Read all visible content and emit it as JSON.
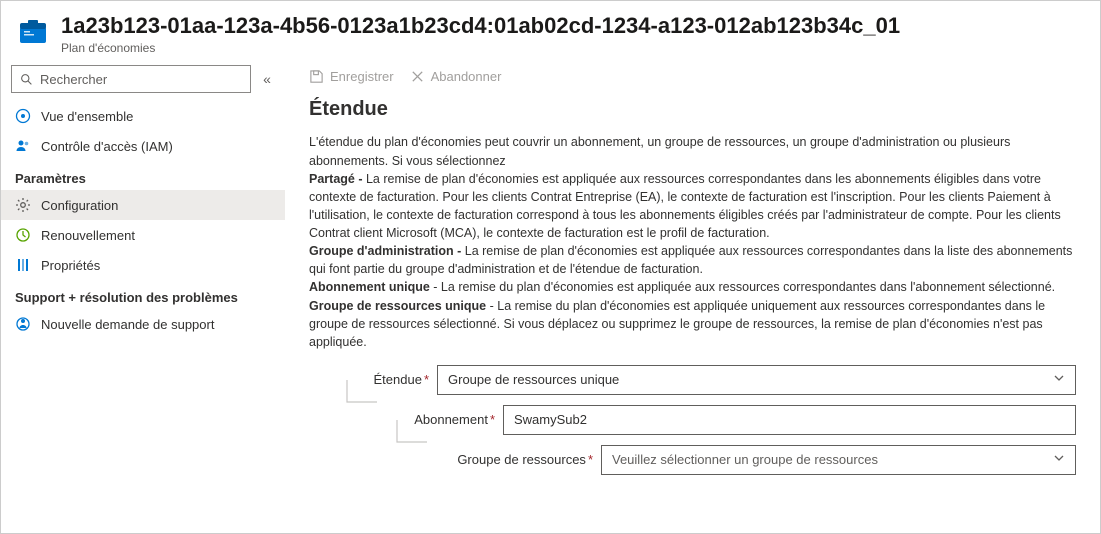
{
  "header": {
    "title": "1a23b123-01aa-123a-4b56-0123a1b23cd4:01ab02cd-1234-a123-012ab123b34c_01",
    "subtitle": "Plan d'économies"
  },
  "sidebar": {
    "search_placeholder": "Rechercher",
    "items": {
      "overview": "Vue d'ensemble",
      "iam": "Contrôle d'accès (IAM)",
      "section_settings": "Paramètres",
      "configuration": "Configuration",
      "renewal": "Renouvellement",
      "properties": "Propriétés",
      "section_support": "Support + résolution des problèmes",
      "new_support": "Nouvelle demande de support"
    }
  },
  "toolbar": {
    "save": "Enregistrer",
    "discard": "Abandonner"
  },
  "main": {
    "heading": "Étendue",
    "intro": "L'étendue du plan d'économies peut couvrir un abonnement, un groupe de ressources, un groupe d'administration ou plusieurs abonnements. Si vous sélectionnez",
    "shared_label": "Partagé - ",
    "shared_text": "La remise de plan d'économies est appliquée aux ressources correspondantes dans les abonnements éligibles dans votre contexte de facturation. Pour les clients Contrat Entreprise (EA), le contexte de facturation est l'inscription. Pour les clients Paiement à l'utilisation, le contexte de facturation correspond à tous les abonnements éligibles créés par l'administrateur de compte. Pour les clients Contrat client Microsoft (MCA), le contexte de facturation est le profil de facturation.",
    "mg_label": "Groupe d'administration - ",
    "mg_text": "La remise de plan d'économies est appliquée aux ressources correspondantes dans la liste des abonnements qui font partie du groupe d'administration et de l'étendue de facturation.",
    "single_sub_label": "Abonnement unique",
    "single_sub_text": " - La remise du plan d'économies est appliquée aux ressources correspondantes dans l'abonnement sélectionné.",
    "single_rg_label": "Groupe de ressources unique",
    "single_rg_text": " - La remise du plan d'économies est appliquée uniquement aux ressources correspondantes dans le groupe de ressources sélectionné. Si vous déplacez ou supprimez le groupe de ressources, la remise de plan d'économies n'est pas appliquée."
  },
  "form": {
    "scope_label": "Étendue",
    "scope_value": "Groupe de ressources unique",
    "subscription_label": "Abonnement",
    "subscription_value": "SwamySub2",
    "rg_label": "Groupe de ressources",
    "rg_placeholder": "Veuillez sélectionner un groupe de ressources"
  }
}
